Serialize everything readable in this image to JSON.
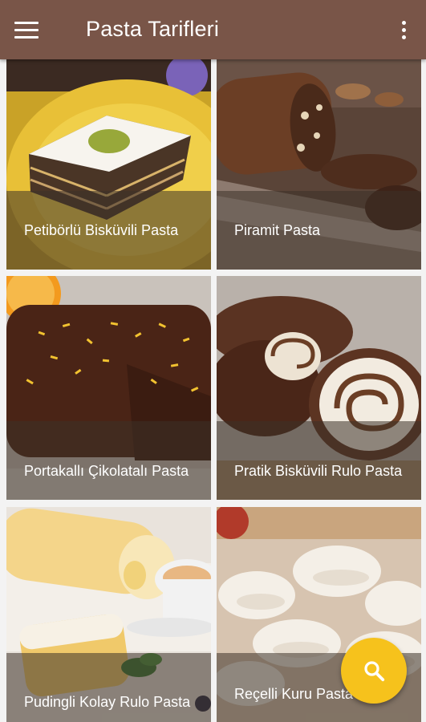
{
  "app_bar": {
    "title": "Pasta Tarifleri",
    "menu_icon": "hamburger-menu-icon",
    "overflow_icon": "more-vert-icon",
    "color": "#795548"
  },
  "recipes": [
    {
      "name": "Petibörlü Bisküvili Pasta",
      "image": "layered-biscuit-cake-photo"
    },
    {
      "name": "Piramit Pasta",
      "image": "chocolate-log-cake-photo"
    },
    {
      "name": "Portakallı Çikolatalı Pasta",
      "image": "orange-chocolate-cake-photo"
    },
    {
      "name": "Pratik Bisküvili Rulo Pasta",
      "image": "chocolate-roll-cake-photo"
    },
    {
      "name": "Pudingli Kolay Rulo Pasta",
      "image": "pudding-roll-cake-photo"
    },
    {
      "name": "Reçelli Kuru Pasta",
      "image": "jam-cookies-photo"
    }
  ],
  "fab": {
    "icon": "search-icon",
    "color": "#f6c21c"
  }
}
